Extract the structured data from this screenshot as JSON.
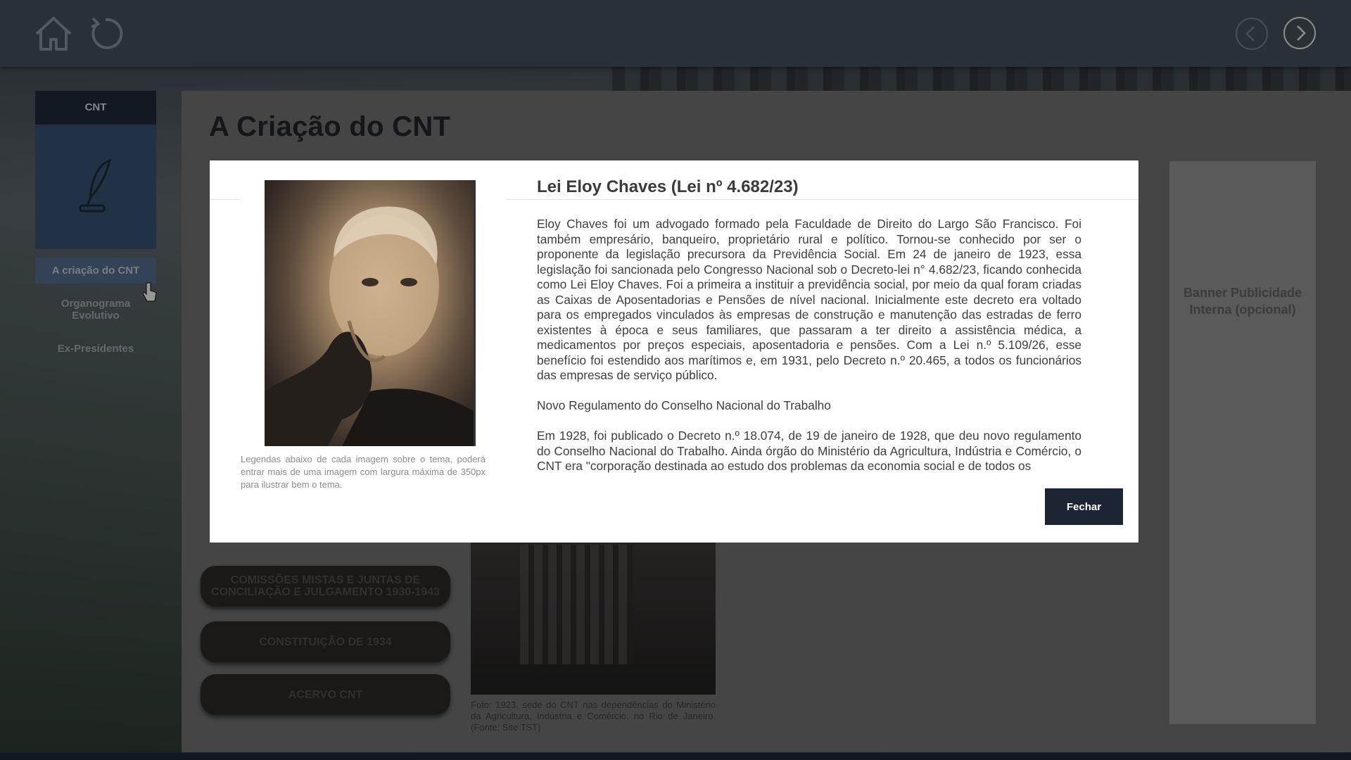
{
  "page": {
    "title": "A Criação do CNT",
    "banner": "Banner Publicidade Interna (opcional)"
  },
  "sidebar": {
    "header": "CNT",
    "items": [
      {
        "label": "A criação do CNT",
        "active": true
      },
      {
        "label": "Organograma Evolutivo",
        "active": false
      },
      {
        "label": "Ex-Presidentes",
        "active": false
      }
    ]
  },
  "topics": [
    {
      "label": "COMISSÕES MISTAS E JUNTAS DE CONCILIAÇÃO E JULGAMENTO 1930-1943"
    },
    {
      "label": "CONSTITUIÇÃO DE 1934"
    },
    {
      "label": "ACERVO CNT"
    }
  ],
  "building_caption": "Foto: 1923, sede do CNT nas dependências do Ministério da Agricultura, Indústria e Comércio, no Rio de Janeiro. (Fonte: Site TST)",
  "modal": {
    "title": "Lei Eloy Chaves (Lei nº 4.682/23)",
    "image_caption": "Legendas abaixo de cada imagem sobre o tema, poderá entrar mais de uma imagem com largura máxima de 350px para ilustrar bem o tema.",
    "paragraphs": [
      "Eloy Chaves foi um advogado formado pela Faculdade de Direito do Largo São Francisco. Foi também empresário, banqueiro, proprietário rural e político. Tornou-se conhecido por ser o proponente da legislação precursora da Previdência Social. Em 24 de janeiro de 1923, essa legislação foi sancionada pelo Congresso Nacional sob o Decreto-lei n° 4.682/23, ficando conhecida como Lei Eloy Chaves. Foi a primeira a instituir a previdência social, por meio da qual foram criadas as Caixas de Aposentadorias e Pensões de nível nacional. Inicialmente este decreto era voltado para os empregados vinculados às empresas de construção e manutenção das estradas de ferro existentes à época e seus familiares, que passaram a ter direito a assistência médica, a medicamentos por preços especiais, aposentadoria e pensões. Com a Lei n.º 5.109/26, esse benefício foi estendido aos marítimos e, em 1931, pelo Decreto n.º 20.465, a todos os funcionários das empresas de serviço público.",
      "Novo Regulamento do Conselho Nacional do Trabalho",
      "Em 1928, foi publicado o Decreto n.º 18.074, de 19 de janeiro de 1928, que deu novo regulamento do Conselho Nacional do Trabalho. Ainda órgão do Ministério da Agricultura, Indústria e Comércio, o CNT era \"corporação destinada ao estudo dos problemas da economia social e de todos os"
    ],
    "close_label": "Fechar"
  },
  "colors": {
    "topbar": "#3f4a54",
    "sidebar_card": "#334d6e",
    "close_button": "#1c2533"
  }
}
